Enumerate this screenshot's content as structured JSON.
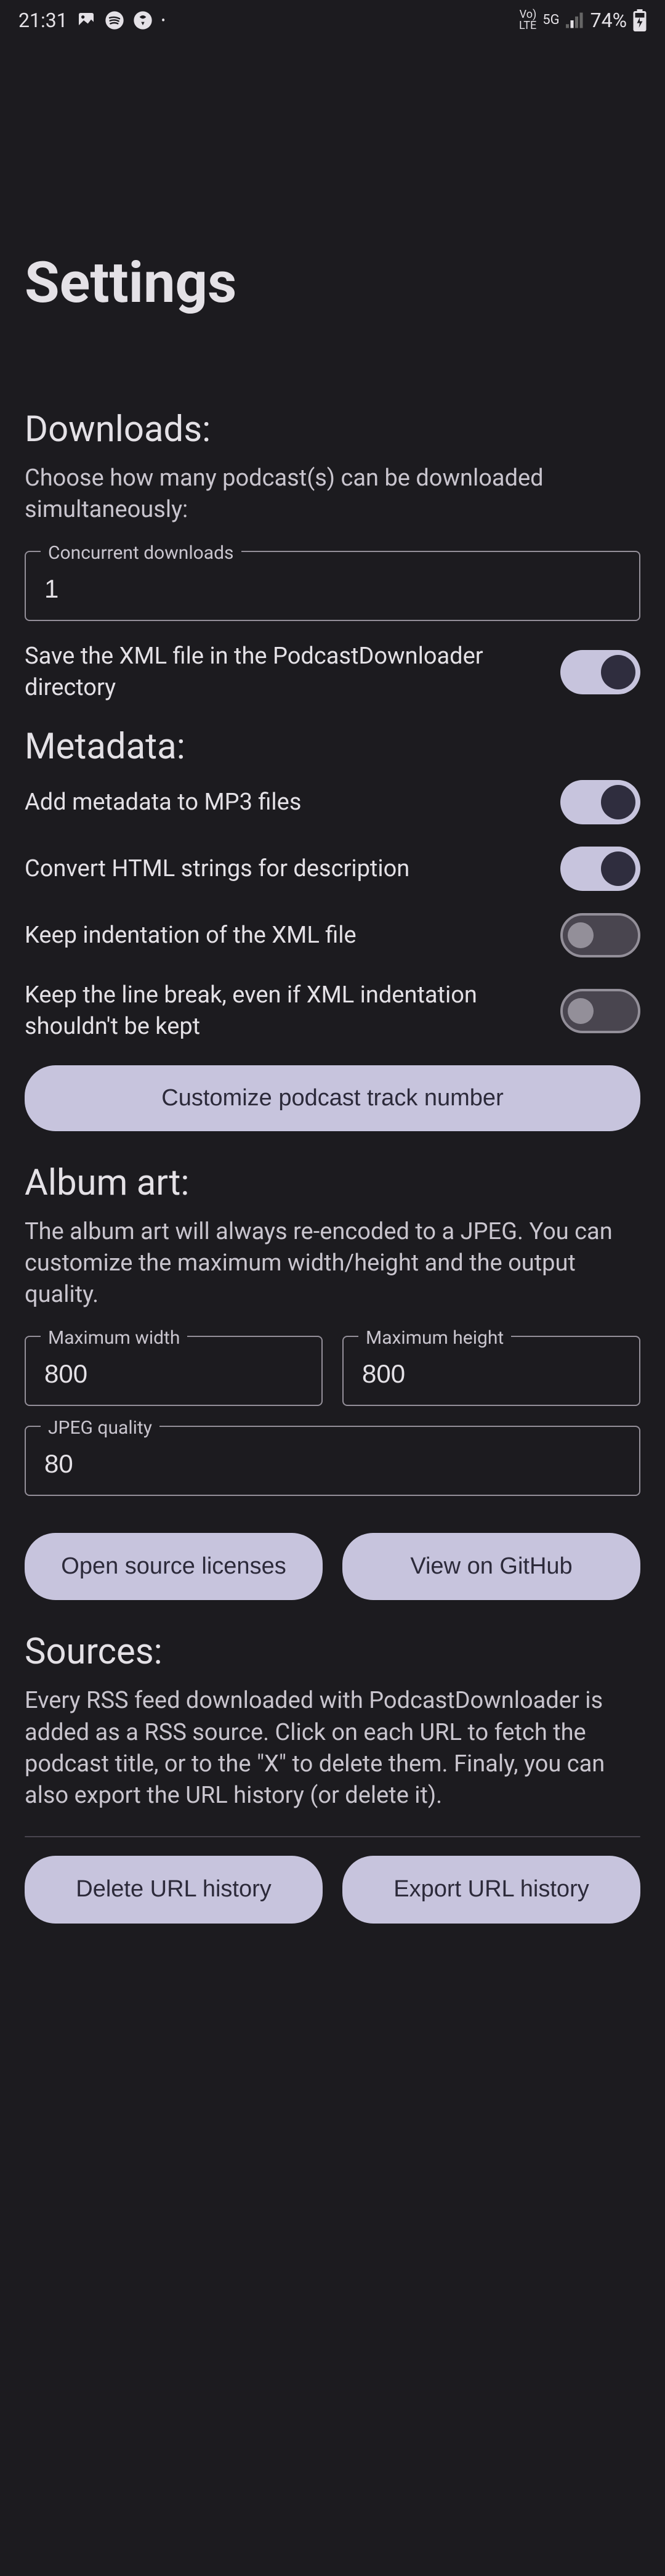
{
  "status_bar": {
    "time": "21:31",
    "battery": "74%",
    "net1": "Vo)",
    "net2": "LTE",
    "net3": "5G"
  },
  "page_title": "Settings",
  "downloads": {
    "title": "Downloads:",
    "desc": "Choose how many podcast(s) can be downloaded simultaneously:",
    "concurrent_label": "Concurrent downloads",
    "concurrent_value": "1",
    "save_xml_label": "Save the XML file in the PodcastDownloader directory"
  },
  "metadata": {
    "title": "Metadata:",
    "add_metadata_label": "Add metadata to MP3 files",
    "convert_html_label": "Convert HTML strings for description",
    "keep_indent_label": "Keep indentation of the XML file",
    "keep_linebreak_label": "Keep the line break, even if XML indentation shouldn't be kept",
    "customize_button": "Customize podcast track number"
  },
  "album_art": {
    "title": "Album art:",
    "desc": "The album art will always re-encoded to a JPEG. You can customize the maximum width/height and the output quality.",
    "max_width_label": "Maximum width",
    "max_width_value": "800",
    "max_height_label": "Maximum height",
    "max_height_value": "800",
    "jpeg_quality_label": "JPEG quality",
    "jpeg_quality_value": "80",
    "licenses_button": "Open source licenses",
    "github_button": "View on GitHub"
  },
  "sources": {
    "title": "Sources:",
    "desc": "Every RSS feed downloaded with PodcastDownloader is added as a RSS source. Click on each URL to fetch the podcast title, or to the \"X\" to delete them. Finaly, you can also export the URL history (or delete it).",
    "delete_button": "Delete URL history",
    "export_button": "Export URL history"
  }
}
